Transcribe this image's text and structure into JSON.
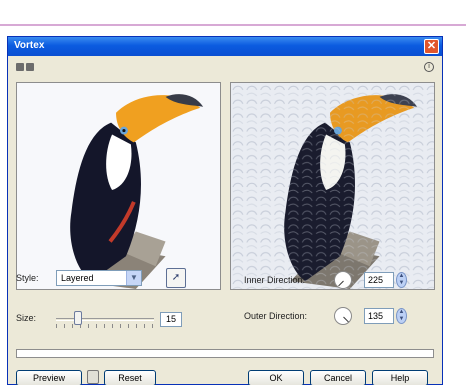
{
  "window": {
    "title": "Vortex",
    "close_glyph": "✕"
  },
  "header_icons": [
    "compare-view-icon",
    "split-view-icon"
  ],
  "info_icon": "info-icon",
  "controls": {
    "style_label": "Style:",
    "style_value": "Layered",
    "size_label": "Size:",
    "size_value": "15",
    "size_slider_fraction": 0.2,
    "inner_direction_label": "Inner Direction:",
    "inner_direction_value": "225",
    "outer_direction_label": "Outer Direction:",
    "outer_direction_value": "135"
  },
  "buttons": {
    "preview": "Preview",
    "reset": "Reset",
    "ok": "OK",
    "cancel": "Cancel",
    "help": "Help"
  },
  "colors": {
    "titlebar": "#0b5be0",
    "dialog_bg": "#ece9d8",
    "toucan_beak": "#f0a020"
  }
}
